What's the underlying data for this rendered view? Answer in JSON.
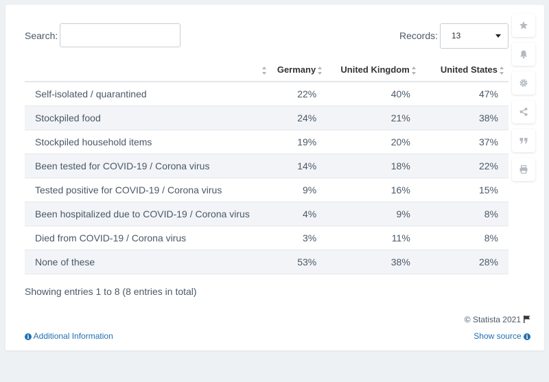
{
  "search": {
    "label": "Search:",
    "value": "",
    "placeholder": ""
  },
  "records": {
    "label": "Records:",
    "selected": "13"
  },
  "table": {
    "headers": [
      "",
      "Germany",
      "United Kingdom",
      "United States"
    ],
    "rows": [
      {
        "label": "Self-isolated / quarantined",
        "germany": "22%",
        "uk": "40%",
        "us": "47%"
      },
      {
        "label": "Stockpiled food",
        "germany": "24%",
        "uk": "21%",
        "us": "38%"
      },
      {
        "label": "Stockpiled household items",
        "germany": "19%",
        "uk": "20%",
        "us": "37%"
      },
      {
        "label": "Been tested for COVID-19 / Corona virus",
        "germany": "14%",
        "uk": "18%",
        "us": "22%"
      },
      {
        "label": "Tested positive for COVID-19 / Corona virus",
        "germany": "9%",
        "uk": "16%",
        "us": "15%"
      },
      {
        "label": "Been hospitalized due to COVID-19 / Corona virus",
        "germany": "4%",
        "uk": "9%",
        "us": "8%"
      },
      {
        "label": "Died from COVID-19 / Corona virus",
        "germany": "3%",
        "uk": "11%",
        "us": "8%"
      },
      {
        "label": "None of these",
        "germany": "53%",
        "uk": "38%",
        "us": "28%"
      }
    ]
  },
  "footer": {
    "entries_text": "Showing entries 1 to 8 (8 entries in total)",
    "credit": "© Statista 2021",
    "additional_info": "Additional Information",
    "show_source": "Show source"
  },
  "side_tools": [
    "star-icon",
    "bell-icon",
    "gear-icon",
    "share-icon",
    "quote-icon",
    "print-icon"
  ],
  "colors": {
    "link": "#1f6fb2",
    "row_alt": "#f2f4f7",
    "text": "#4a5866",
    "icon": "#b4bac0"
  }
}
